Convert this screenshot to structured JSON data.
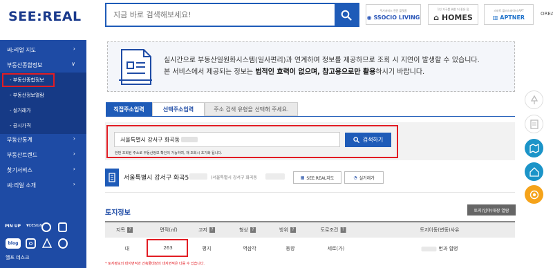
{
  "header": {
    "logo": "SEE:REAL",
    "search_placeholder": "지금 바로 검색해보세요!",
    "partners": [
      {
        "sub": "주거서비스 전문 플랫폼",
        "main": "SSOCIO LIVING"
      },
      {
        "sub": "1인 가구를 위한 더 좋은 집",
        "main": "HOMES"
      },
      {
        "sub": "스마트 플러스데이터 APT",
        "main": "APTNER"
      }
    ],
    "lang": "OREAN ∨"
  },
  "sidebar": {
    "items": [
      {
        "label": "씨:리얼 지도",
        "chev": "›"
      },
      {
        "label": "부동산종합정보",
        "chev": "∨"
      },
      {
        "label": "부동산통계",
        "chev": "›"
      },
      {
        "label": "부동산트렌드",
        "chev": "›"
      },
      {
        "label": "찾기서비스",
        "chev": "›"
      },
      {
        "label": "씨:리얼 소개",
        "chev": "›"
      }
    ],
    "sub_items": [
      {
        "label": "- 부동산종합정보"
      },
      {
        "label": "- 부동산정보열람"
      },
      {
        "label": "- 실거래가"
      },
      {
        "label": "- 공시가격"
      }
    ],
    "bottom_labels": {
      "pinup": "PIN UP",
      "design": "DESIGN",
      "blog": "blog"
    },
    "help": "헬프 데스크"
  },
  "notice": {
    "line1": "실시간으로 부동산일원화시스템(일사편리)과 연계하여 정보를 제공하므로 조회 시 지연이 발생할 수 있습니다.",
    "line2_pre": "본 서비스에서 제공되는 정보는 ",
    "line2_bold": "법적인 효력이 없으며, 참고용으로만 활용",
    "line2_post": "하시기 바랍니다."
  },
  "tabs": {
    "direct": "직접주소입력",
    "select": "선택주소입력",
    "hint": "주소 검색 유형을 선택해 주세요."
  },
  "address_search": {
    "value": "서울특별시 강서구 화곡동",
    "button": "검색하기",
    "note": "한번 조회된 주소로 부동산정보 확인이 가능하며, 재 조회시 초기화 됩니다."
  },
  "result": {
    "address": "서울특별시 강서구 화곡5",
    "sub_address": "(서울특별시 강서구 화곡동",
    "btn_map": "SEE:REAL지도",
    "btn_trade": "실거래가"
  },
  "land": {
    "title": "토지정보",
    "ledger_button": "토지(임야)대장 열람",
    "headers": [
      "지목",
      "면적(㎡)",
      "고저",
      "형상",
      "방위",
      "도로조건",
      "토지이동(변동)사유"
    ],
    "row": [
      "대",
      "263",
      "평지",
      "역삼각",
      "동향",
      "세로(가)",
      "번과 합병"
    ],
    "footnote": "* 토지정보의 대지면적과 건축물대장의 대지면적은 다를 수 있습니다."
  },
  "colors": {
    "brand_blue": "#1e4ba5",
    "accent_blue": "#1e5bb8",
    "highlight_red": "#e21c23",
    "quick_orange": "#f5a31a",
    "quick_teal": "#1b94c8"
  }
}
